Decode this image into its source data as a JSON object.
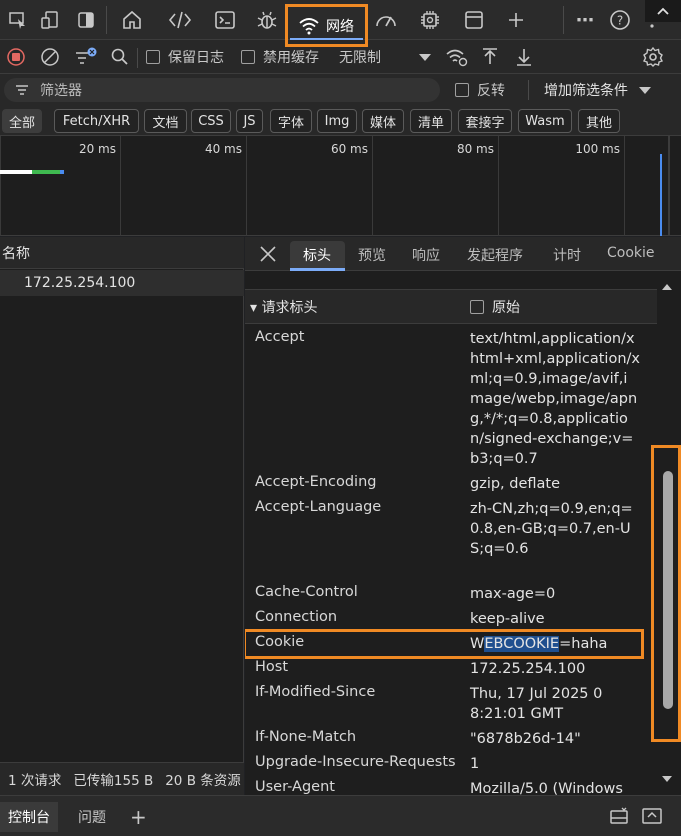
{
  "topbar": {
    "tabs": [
      "inspect-element-icon",
      "device-toggle-icon",
      "dock-side-icon",
      "home-icon",
      "elements-icon",
      "console-icon",
      "sources-bug-icon",
      "network-icon",
      "performance-icon",
      "memory-chip-icon",
      "application-icon",
      "add-tab-icon"
    ],
    "network_label": "网络",
    "more_label": "⋯",
    "help_label": "?"
  },
  "toolbar": {
    "preserve_log": "保留日志",
    "disable_cache": "禁用缓存",
    "throttling": "无限制"
  },
  "filter": {
    "placeholder": "筛选器",
    "invert": "反转",
    "more_filters": "增加筛选条件"
  },
  "chips": [
    "全部",
    "Fetch/XHR",
    "文档",
    "CSS",
    "JS",
    "字体",
    "Img",
    "媒体",
    "清单",
    "套接字",
    "Wasm",
    "其他"
  ],
  "timeline": {
    "ticks": [
      "20 ms",
      "40 ms",
      "60 ms",
      "80 ms",
      "100 ms"
    ]
  },
  "request_list": {
    "column_name": "名称",
    "rows": [
      "172.25.254.100"
    ]
  },
  "status": {
    "requests": "1 次请求",
    "transferred": "已传输155 B",
    "resources": "20 B 条资源"
  },
  "detail": {
    "tabs": [
      "标头",
      "预览",
      "响应",
      "发起程序",
      "计时",
      "Cookie"
    ],
    "section_title": "▾ 请求标头",
    "raw_label": "原始",
    "headers": [
      {
        "name": "Accept",
        "value": "text/html,application/xhtml+xml,application/xml;q=0.9,image/avif,image/webp,image/apng,*/*;q=0.8,application/signed-exchange;v=b3;q=0.7"
      },
      {
        "name": "Accept-Encoding",
        "value": "gzip, deflate"
      },
      {
        "name": "Accept-Language",
        "value": "zh-CN,zh;q=0.9,en;q=0.8,en-GB;q=0.7,en-US;q=0.6"
      },
      {
        "name": "Cache-Control",
        "value": "max-age=0"
      },
      {
        "name": "Connection",
        "value": "keep-alive"
      },
      {
        "name": "Cookie",
        "value_pre": "W",
        "value_sel": "EBCOOKIE",
        "value_post": "=haha"
      },
      {
        "name": "Host",
        "value": "172.25.254.100"
      },
      {
        "name": "If-Modified-Since",
        "value": "Thu, 17 Jul 2025 08:21:01 GMT"
      },
      {
        "name": "If-None-Match",
        "value": "\"6878b26d-14\""
      },
      {
        "name": "Upgrade-Insecure-Requests",
        "value": "1"
      },
      {
        "name": "User-Agent",
        "value": "Mozilla/5.0 (Windows"
      }
    ]
  },
  "drawer": {
    "console": "控制台",
    "issues": "问题",
    "add": "+"
  },
  "colors": {
    "highlight_orange": "#f08a24",
    "accent_blue": "#7cacf8",
    "record_red": "#e46962"
  }
}
